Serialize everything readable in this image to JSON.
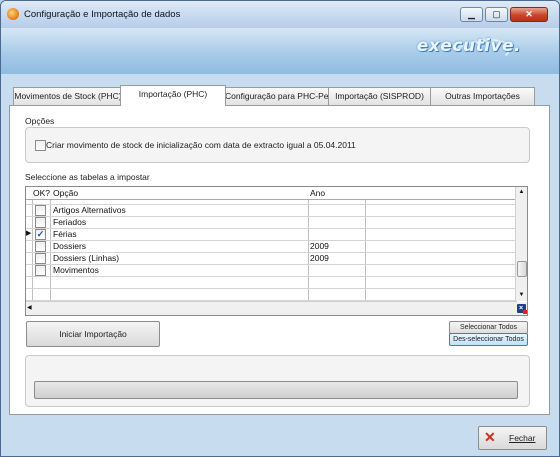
{
  "window": {
    "title": "Configuração e Importação de dados"
  },
  "brand": {
    "logo_text": "executive."
  },
  "tabs": [
    {
      "label": "Movimentos de Stock (PHC)"
    },
    {
      "label": "Importação (PHC)"
    },
    {
      "label": "Configuração para PHC-Pes"
    },
    {
      "label": "Importação (SISPROD)"
    },
    {
      "label": "Outras Importações"
    }
  ],
  "options": {
    "section_label": "Opções",
    "init_stock_checkbox_label": "Criar movimento de stock de inicialização com data de extracto igual a 05.04.2011",
    "init_stock_checked": false
  },
  "tables": {
    "section_label": "Seleccione as tabelas a impostar",
    "columns": {
      "ok": "OK?",
      "opcao": "Opção",
      "ano": "Ano"
    },
    "rows": [
      {
        "checked": false,
        "opcao": "Artigos Alternativos",
        "ano": "",
        "current": false
      },
      {
        "checked": false,
        "opcao": "Feriados",
        "ano": "",
        "current": false
      },
      {
        "checked": true,
        "opcao": "Férias",
        "ano": "",
        "current": true
      },
      {
        "checked": false,
        "opcao": "Dossiers",
        "ano": "2009",
        "current": false
      },
      {
        "checked": false,
        "opcao": "Dossiers (Linhas)",
        "ano": "2009",
        "current": false
      },
      {
        "checked": false,
        "opcao": "Movimentos",
        "ano": "",
        "current": false
      }
    ]
  },
  "buttons": {
    "start_import": "Iniciar Importação",
    "select_all": "Seleccionar Todos",
    "deselect_all": "Des-seleccionar Todos",
    "exit": "Fechar"
  }
}
